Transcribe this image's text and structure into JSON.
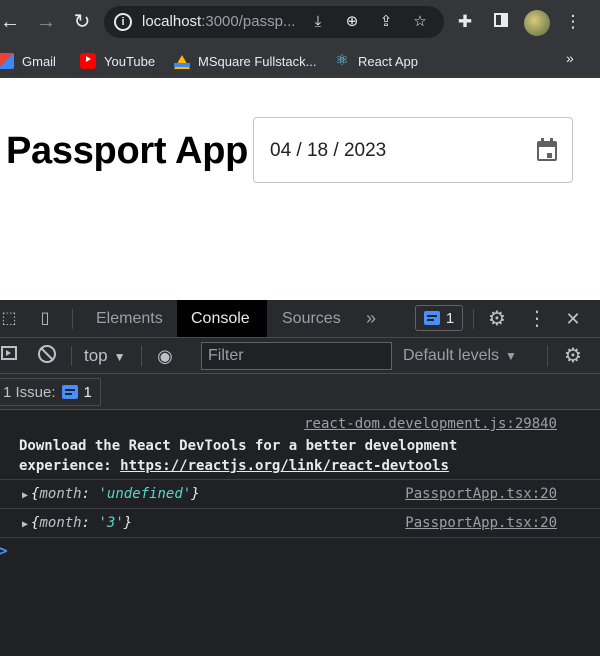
{
  "browser": {
    "url_host": "localhost",
    "url_rest": ":3000/passp...",
    "bookmarks": [
      {
        "label": "Gmail",
        "icon": "gmail-icon"
      },
      {
        "label": "YouTube",
        "icon": "youtube-icon"
      },
      {
        "label": "MSquare Fullstack...",
        "icon": "google-drive-icon"
      },
      {
        "label": "React App",
        "icon": "react-icon"
      }
    ],
    "bookmarks_more": "»"
  },
  "page": {
    "title": "Passport App",
    "date_value": "04 / 18 / 2023"
  },
  "devtools": {
    "tabs": {
      "elements": "Elements",
      "console": "Console",
      "sources": "Sources",
      "more": "»"
    },
    "issues_count": "1",
    "context": "top",
    "filter_placeholder": "Filter",
    "levels": "Default levels",
    "issues_label": "1 Issue:",
    "issues_chip_count": "1",
    "logs": [
      {
        "source": "react-dom.development.js:29840",
        "line1": "Download the React DevTools for a better development",
        "line2_prefix": "experience: ",
        "line2_url": "https://reactjs.org/link/react-devtools"
      },
      {
        "source": "PassportApp.tsx:20",
        "key": "month",
        "value": "'undefined'"
      },
      {
        "source": "PassportApp.tsx:20",
        "key": "month",
        "value": "'3'"
      }
    ],
    "prompt": ">"
  },
  "colors": {
    "chrome_bg": "#35363a",
    "devtools_bg": "#202124",
    "accent_blue": "#4a8ff7",
    "string_value": "#5cd5c8"
  }
}
